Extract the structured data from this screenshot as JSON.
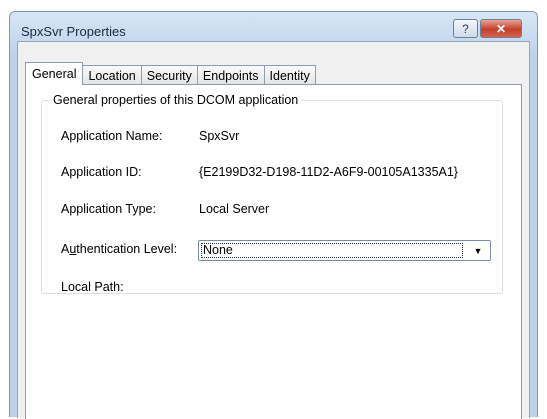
{
  "window": {
    "title": "SpxSvr Properties",
    "help_label": "?",
    "close_label": "✕"
  },
  "tabs": [
    {
      "label": "General",
      "active": true
    },
    {
      "label": "Location"
    },
    {
      "label": "Security"
    },
    {
      "label": "Endpoints"
    },
    {
      "label": "Identity"
    }
  ],
  "general": {
    "group_title": "General properties of this DCOM application",
    "app_name_label": "Application Name:",
    "app_name_value": "SpxSvr",
    "app_id_label": "Application ID:",
    "app_id_value": "{E2199D32-D198-11D2-A6F9-00105A1335A1}",
    "app_type_label": "Application Type:",
    "app_type_value": "Local Server",
    "auth_label_prefix": "A",
    "auth_label_underlined": "u",
    "auth_label_rest": "thentication Level:",
    "auth_value": "None",
    "local_path_label": "Local Path:"
  },
  "icons": {
    "dropdown": "chevron-down-icon"
  }
}
